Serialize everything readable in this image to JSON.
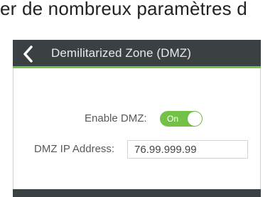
{
  "page": {
    "top_text": "er de nombreux paramètres d"
  },
  "header": {
    "title": "Demilitarized Zone (DMZ)",
    "back_icon": "chevron-left-icon"
  },
  "dmz": {
    "enable_label": "Enable DMZ:",
    "toggle_state": "On",
    "ip_label": "DMZ IP Address:",
    "ip_value": "76.99.999.99"
  },
  "colors": {
    "header_bg": "#3b4043",
    "accent_green": "#72c247",
    "header_text": "#e8eaea"
  }
}
